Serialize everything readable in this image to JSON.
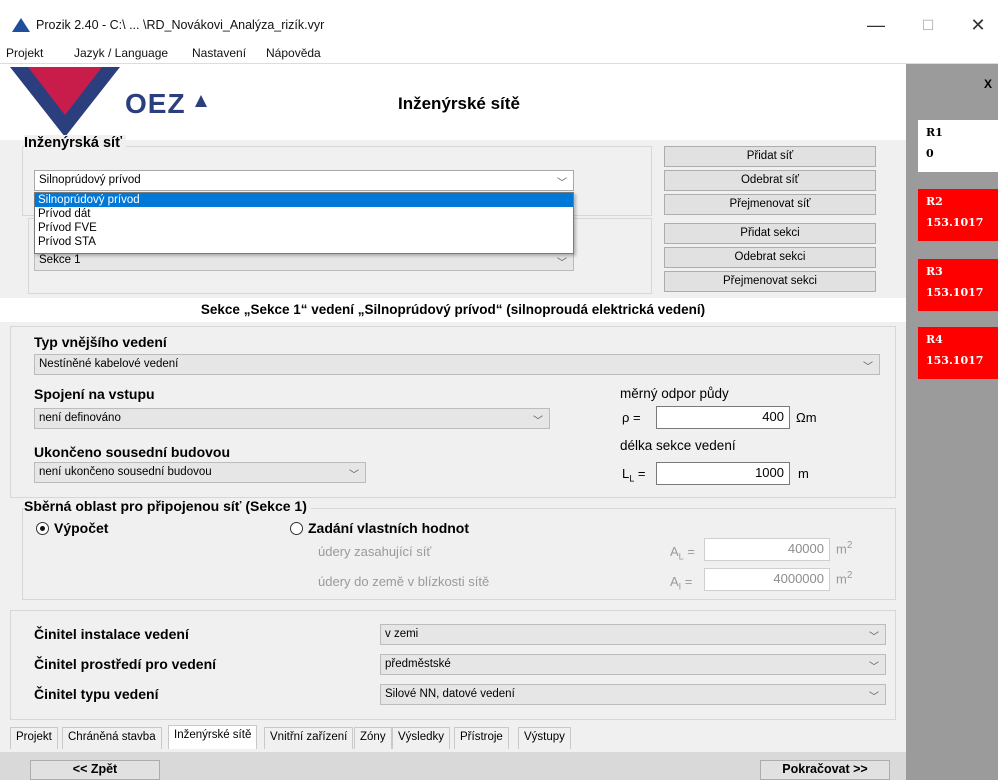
{
  "window": {
    "title": "Prozik 2.40 - C:\\ ... \\RD_Novákovi_Analýza_rizík.vyr",
    "minimize": "—",
    "maximize": "☐",
    "close": "✕"
  },
  "menu": [
    "Projekt",
    "Jazyk / Language",
    "Nastavení",
    "Nápověda"
  ],
  "header": {
    "logo_text": "OEZ",
    "page_title": "Inženýrské sítě"
  },
  "network": {
    "group_label": "Inženýrská síť",
    "selected": "Silnoprúdový prívod",
    "options": [
      "Silnoprúdový prívod",
      "Prívod dát",
      "Prívod FVE",
      "Prívod STA"
    ],
    "buttons": {
      "add": "Přidat síť",
      "remove": "Odebrat síť",
      "rename": "Přejmenovat síť"
    }
  },
  "sectionbox": {
    "selected": "Sekce 1",
    "buttons": {
      "add": "Přidat sekci",
      "remove": "Odebrat sekci",
      "rename": "Přejmenovat sekci"
    }
  },
  "section_title": "Sekce „Sekce 1“ vedení „Silnoprúdový prívod“ (silnoproudá elektrická vedení)",
  "line_type": {
    "label": "Typ vnějšího vedení",
    "value": "Nestíněné kabelové vedení"
  },
  "input_connection": {
    "label": "Spojení na vstupu",
    "value": "není definováno"
  },
  "terminated": {
    "label": "Ukončeno sousední budovou",
    "value": "není ukončeno sousední budovou"
  },
  "soil": {
    "label": "měrný odpor půdy",
    "symbol": "ρ  =",
    "value": "400",
    "unit": "Ωm"
  },
  "length": {
    "label": "délka sekce vedení",
    "symbol": "L",
    "sub": "L",
    "eq": " =",
    "value": "1000",
    "unit": "m"
  },
  "collection": {
    "title": "Sběrná oblast pro připojenou síť (Sekce 1)",
    "radio_calc": "Výpočet",
    "radio_custom": "Zadání vlastních hodnot",
    "selected": "calc",
    "strikes_line": {
      "label": "údery zasahující síť",
      "symbol": "A",
      "sub": "L",
      "eq": " =",
      "value": "40000",
      "unit": "m",
      "sup": "2"
    },
    "strikes_near": {
      "label": "údery do země v blízkosti sítě",
      "symbol": "A",
      "sub": "I",
      "eq": " =",
      "value": "4000000",
      "unit": "m",
      "sup": "2"
    }
  },
  "factors": {
    "installation": {
      "label": "Činitel instalace vedení",
      "value": "v zemi"
    },
    "environment": {
      "label": "Činitel prostředí pro vedení",
      "value": "předměstské"
    },
    "type": {
      "label": "Činitel typu vedení",
      "value": "Silové NN, datové vedení"
    }
  },
  "tabs": [
    "Projekt",
    "Chráněná stavba",
    "Inženýrské sítě",
    "Vnitřní zařízení",
    "Zóny",
    "Výsledky",
    "Přístroje",
    "Výstupy"
  ],
  "active_tab": "Inženýrské sítě",
  "nav": {
    "back": "<< Zpět",
    "next": "Pokračovat >>"
  },
  "risk_panel": {
    "close": "X",
    "cards": [
      {
        "name": "R1",
        "value": "0",
        "color": "#ffffff"
      },
      {
        "name": "R2",
        "value": "153.1017",
        "color": "#ff0000"
      },
      {
        "name": "R3",
        "value": "153.1017",
        "color": "#ff0000"
      },
      {
        "name": "R4",
        "value": "153.1017",
        "color": "#ff0000"
      }
    ]
  }
}
